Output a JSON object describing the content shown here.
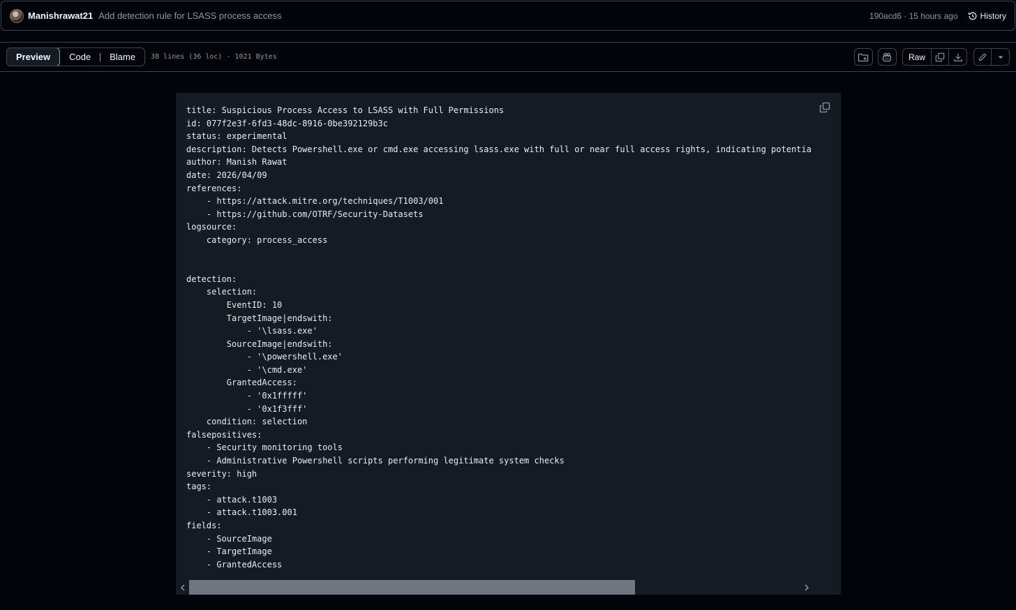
{
  "commit": {
    "author": "Manishrawat21",
    "message": "Add detection rule for LSASS process access",
    "meta": "190acd6 · 15 hours ago",
    "history_label": "History"
  },
  "file_header": {
    "tabs": [
      "Preview",
      "Code",
      "Blame"
    ],
    "active_tab": "Preview",
    "info": "38 lines (36 loc) · 1021 Bytes",
    "raw_label": "Raw"
  },
  "icons": {
    "history": "history-icon",
    "new_file": "file-directory-add-icon",
    "copilot": "copilot-icon",
    "copy_raw": "copy-icon",
    "download": "download-icon",
    "edit": "pencil-icon",
    "more": "triangle-down-icon",
    "copy_code": "copy-icon"
  },
  "code": {
    "lines": [
      "title: Suspicious Process Access to LSASS with Full Permissions",
      "id: 077f2e3f-6fd3-48dc-8916-0be392129b3c",
      "status: experimental",
      "description: Detects Powershell.exe or cmd.exe accessing lsass.exe with full or near full access rights, indicating potential c",
      "author: Manish Rawat",
      "date: 2026/04/09",
      "references:",
      "    - https://attack.mitre.org/techniques/T1003/001",
      "    - https://github.com/OTRF/Security-Datasets",
      "logsource:",
      "    category: process_access",
      "",
      "",
      "detection:",
      "    selection:",
      "        EventID: 10",
      "        TargetImage|endswith:",
      "            - '\\lsass.exe'",
      "        SourceImage|endswith:",
      "            - '\\powershell.exe'",
      "            - '\\cmd.exe'",
      "        GrantedAccess:",
      "            - '0x1fffff'",
      "            - '0x1f3fff'",
      "    condition: selection",
      "falsepositives:",
      "    - Security monitoring tools",
      "    - Administrative Powershell scripts performing legitimate system checks",
      "severity: high",
      "tags:",
      "    - attack.t1003",
      "    - attack.t1003.001",
      "fields:",
      "    - SourceImage",
      "    - TargetImage",
      "    - GrantedAccess"
    ]
  },
  "scroll": {
    "horizontal_position": 0,
    "visible_fraction": 0.73
  }
}
